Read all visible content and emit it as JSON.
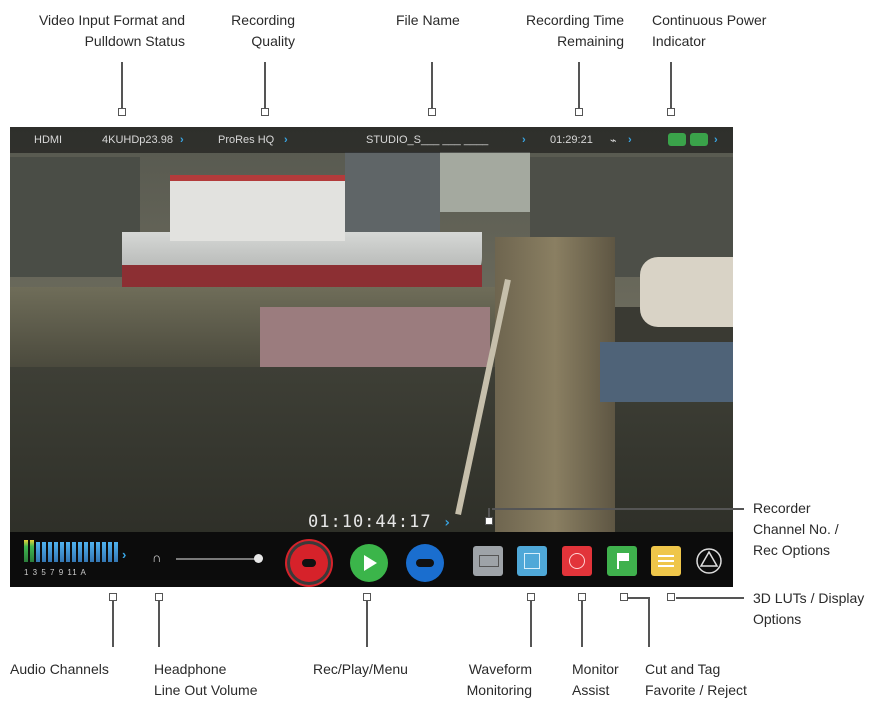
{
  "callouts": {
    "video_input": [
      "Video Input Format and",
      "Pulldown Status"
    ],
    "recording_quality": [
      "Recording",
      "Quality"
    ],
    "file_name": "File Name",
    "recording_time": [
      "Recording Time",
      "Remaining"
    ],
    "continuous_power": [
      "Continuous Power",
      "Indicator"
    ],
    "recorder_channel": [
      "Recorder",
      "Channel No. /",
      "Rec Options"
    ],
    "luts_display": [
      "3D LUTs / Display",
      "Options"
    ],
    "audio_channels": "Audio Channels",
    "headphone": [
      "Headphone",
      "Line Out Volume"
    ],
    "rec_play_menu": "Rec/Play/Menu",
    "waveform": [
      "Waveform",
      "Monitoring"
    ],
    "monitor_assist": [
      "Monitor",
      "Assist"
    ],
    "cut_tag": [
      "Cut and Tag",
      "Favorite / Reject"
    ]
  },
  "status_bar": {
    "input": "HDMI",
    "format": "4KUHDp23.98",
    "codec": "ProRes HQ",
    "file_name": "STUDIO_S___ ___ ____",
    "time_remaining": "01:29:21"
  },
  "timecode": "01:10:44:17",
  "audio_channel_numbers": "1 3 5 7 9 11 A",
  "colors": {
    "record": "#d6222a",
    "play": "#3bb54a",
    "menu": "#1a6ecf",
    "waveform": "#9ea3a8",
    "monitor_assist": "#4fa8d8",
    "focus": "#e2343a",
    "tag": "#3fb14d",
    "luts": "#efc64a",
    "power": "#3aa34a"
  }
}
